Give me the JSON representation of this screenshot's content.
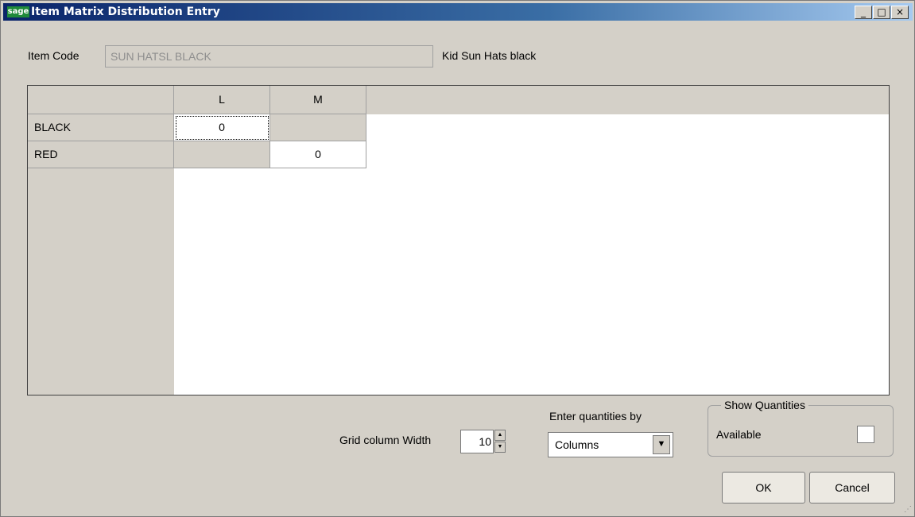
{
  "window": {
    "title": "Item Matrix Distribution Entry",
    "logo": "sage",
    "controls": {
      "minimize": "_",
      "maximize": "□",
      "close": "×"
    }
  },
  "item": {
    "code_label": "Item Code",
    "code_value": "SUN HATSL BLACK",
    "description": "Kid Sun Hats black"
  },
  "grid": {
    "columns": [
      "L",
      "M"
    ],
    "rows": [
      {
        "label": "BLACK",
        "cells": [
          "0",
          ""
        ]
      },
      {
        "label": "RED",
        "cells": [
          "",
          "0"
        ]
      }
    ]
  },
  "controls": {
    "grid_width_label": "Grid column Width",
    "grid_width_value": "10",
    "enter_by_label": "Enter quantities by",
    "enter_by_value": "Columns",
    "show_quantities_legend": "Show Quantities",
    "available_label": "Available",
    "available_checked": false
  },
  "buttons": {
    "ok": "OK",
    "cancel": "Cancel"
  }
}
